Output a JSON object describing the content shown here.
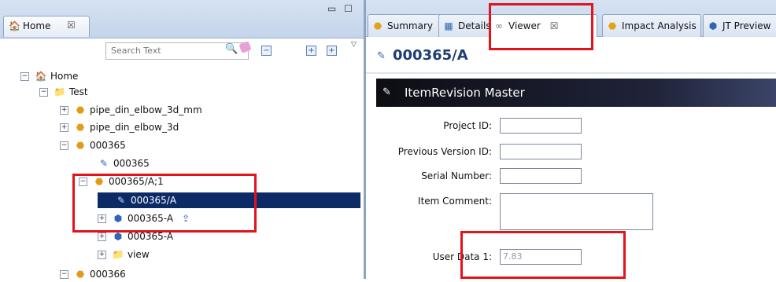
{
  "left_panel": {
    "tab_label": "Home",
    "tab_close": "☒",
    "search_placeholder": "Search Text",
    "tree": [
      {
        "label": "Home"
      },
      {
        "label": "Test"
      },
      {
        "label": "pipe_din_elbow_3d_mm"
      },
      {
        "label": "pipe_din_elbow_3d"
      },
      {
        "label": "000365"
      },
      {
        "label": "000365"
      },
      {
        "label": "000365/A;1"
      },
      {
        "label": "000365/A"
      },
      {
        "label": "000365-A"
      },
      {
        "label": "000365-A"
      },
      {
        "label": "view"
      },
      {
        "label": "000366"
      }
    ]
  },
  "right_panel": {
    "tabs": [
      {
        "label": "Summary"
      },
      {
        "label": "Details"
      },
      {
        "label": "Viewer",
        "close": "☒"
      },
      {
        "label": "Impact Analysis"
      },
      {
        "label": "JT Preview"
      }
    ],
    "title": "000365/A",
    "section_title": "ItemRevision Master",
    "fields": [
      {
        "label": "Project ID:",
        "value": ""
      },
      {
        "label": "Previous Version ID:",
        "value": ""
      },
      {
        "label": "Serial Number:",
        "value": ""
      },
      {
        "label": "Item Comment:",
        "value": ""
      },
      {
        "label": "User Data 1:",
        "value": "7.83"
      }
    ]
  },
  "colors": {
    "selection": "#0b2a66",
    "highlight": "#e3131b",
    "tab_bar": "#c6d6ea"
  }
}
